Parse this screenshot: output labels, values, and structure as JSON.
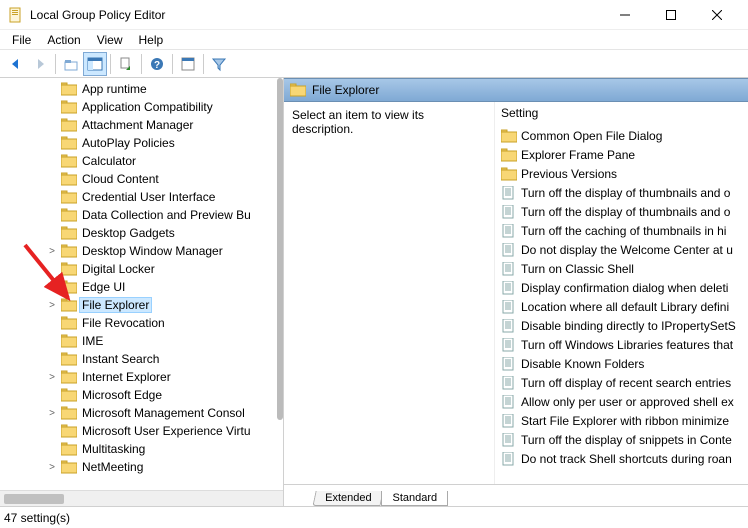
{
  "window": {
    "title": "Local Group Policy Editor"
  },
  "menu": [
    "File",
    "Action",
    "View",
    "Help"
  ],
  "tree": {
    "indent": 60,
    "items": [
      {
        "label": "App runtime",
        "expander": ""
      },
      {
        "label": "Application Compatibility",
        "expander": ""
      },
      {
        "label": "Attachment Manager",
        "expander": ""
      },
      {
        "label": "AutoPlay Policies",
        "expander": ""
      },
      {
        "label": "Calculator",
        "expander": ""
      },
      {
        "label": "Cloud Content",
        "expander": ""
      },
      {
        "label": "Credential User Interface",
        "expander": ""
      },
      {
        "label": "Data Collection and Preview Bu",
        "expander": ""
      },
      {
        "label": "Desktop Gadgets",
        "expander": ""
      },
      {
        "label": "Desktop Window Manager",
        "expander": ">"
      },
      {
        "label": "Digital Locker",
        "expander": ""
      },
      {
        "label": "Edge UI",
        "expander": ""
      },
      {
        "label": "File Explorer",
        "expander": ">",
        "selected": true
      },
      {
        "label": "File Revocation",
        "expander": ""
      },
      {
        "label": "IME",
        "expander": ""
      },
      {
        "label": "Instant Search",
        "expander": ""
      },
      {
        "label": "Internet Explorer",
        "expander": ">"
      },
      {
        "label": "Microsoft Edge",
        "expander": ""
      },
      {
        "label": "Microsoft Management Consol",
        "expander": ">"
      },
      {
        "label": "Microsoft User Experience Virtu",
        "expander": ""
      },
      {
        "label": "Multitasking",
        "expander": ""
      },
      {
        "label": "NetMeeting",
        "expander": ">"
      }
    ]
  },
  "right": {
    "header": "File Explorer",
    "description": "Select an item to view its description.",
    "setting_header": "Setting",
    "settings": [
      {
        "type": "folder",
        "label": "Common Open File Dialog"
      },
      {
        "type": "folder",
        "label": "Explorer Frame Pane"
      },
      {
        "type": "folder",
        "label": "Previous Versions"
      },
      {
        "type": "policy",
        "label": "Turn off the display of thumbnails and o"
      },
      {
        "type": "policy",
        "label": "Turn off the display of thumbnails and o"
      },
      {
        "type": "policy",
        "label": "Turn off the caching of thumbnails in hi"
      },
      {
        "type": "policy",
        "label": "Do not display the Welcome Center at u"
      },
      {
        "type": "policy",
        "label": "Turn on Classic Shell"
      },
      {
        "type": "policy",
        "label": "Display confirmation dialog when deleti"
      },
      {
        "type": "policy",
        "label": "Location where all default Library defini"
      },
      {
        "type": "policy",
        "label": "Disable binding directly to IPropertySetS"
      },
      {
        "type": "policy",
        "label": "Turn off Windows Libraries features that"
      },
      {
        "type": "policy",
        "label": "Disable Known Folders"
      },
      {
        "type": "policy",
        "label": "Turn off display of recent search entries"
      },
      {
        "type": "policy",
        "label": "Allow only per user or approved shell ex"
      },
      {
        "type": "policy",
        "label": "Start File Explorer with ribbon minimize"
      },
      {
        "type": "policy",
        "label": "Turn off the display of snippets in Conte"
      },
      {
        "type": "policy",
        "label": "Do not track Shell shortcuts during roan"
      }
    ],
    "tabs": [
      "Extended",
      "Standard"
    ],
    "active_tab": 1
  },
  "status": "47 setting(s)"
}
